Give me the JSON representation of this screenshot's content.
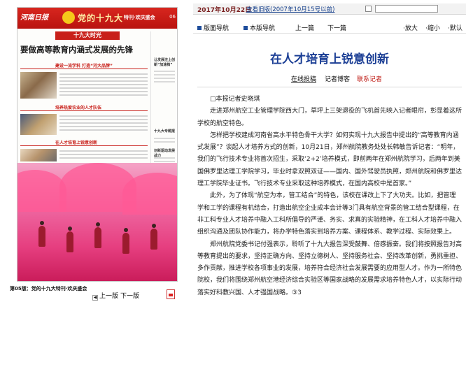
{
  "newspaper": {
    "masthead_logo": "河南日报",
    "masthead_title": "党的十九大",
    "masthead_sub": "特刊·欢庆盛会",
    "page_no": "06",
    "kicker": "十九大时光",
    "headline": "要做高等教育内涵式发展的先锋",
    "side_text_1": "让发展注上创新“加速档”",
    "side_text_2": "十九大专题报",
    "side_text_3": "创新驱动发展战力",
    "section_1": "建设一流学科  打造“河大品牌”",
    "section_2": "培养热爱农业的人才队伍",
    "section_3": "在人才培育上锐意创新"
  },
  "page_nav": {
    "label": "第05版：党的十九大特刊·欢庆盛会",
    "prev": "上一版",
    "next": "下一版",
    "pdf_icon": "pdf-icon"
  },
  "topbar": {
    "date": "2017年10月22日",
    "history_link": "查看旧版(2007年10月15号以前)"
  },
  "navbar": {
    "layout_nav": "版面导航",
    "page_nav": "本版导航",
    "prev_article": "上一篇",
    "next_article": "下一篇",
    "zoom_in": "放大",
    "zoom_out": "缩小",
    "default": "默认"
  },
  "article": {
    "title": "在人才培育上锐意创新",
    "meta_1": "在线投稿",
    "meta_2": "记者博客",
    "meta_3": "联系记者",
    "byline": "□本报记者史晓琪",
    "paragraphs": [
      "走进郑州航空工业管理学院西大门，草坪上三架退役的飞机首先映入记者眼帘，彰显着这所学校的航空特色。",
      "怎样把学校建成河南省高水平特色骨干大学？如何实现十九大报告中提出的“高等教育内涵式发展”？谈起人才培养方式的创新，10月21日，郑州航院教务处处长韩敏告诉记者：“明年，我们的飞行技术专业将首次招生，采取‘2+2’培养模式，即前两年在郑州航院学习，后两年到美国佛罗里达理工学院学习，毕业时拿双照双证——国内、国外驾驶员执照，郑州航院和佛罗里达理工学院毕业证书。飞行技术专业采取这种培养模式，在国内高校中是首家。”",
      "此外，为了体现“航空为本，管工结合”的特色，该校在课改上下了大功夫。比如，把管理学和工学的课程有机结合，打造出航空企业成本会计等3门具有航空背景的管工结合型课程，在非工科专业人才培养中融入工科所倡导的严谨、务实、求真的实验精神，在工科人才培养中融入组织沟通及团队协作能力，将办学特色落实到培养方案、课程体系、教学过程、实际效果上。",
      "郑州航院党委书记付强表示，聆听了十九大报告深受鼓舞、倍感振奋。我们将按照报告对高等教育提出的要求，坚持正确方向、坚持立德树人、坚持服务社会、坚持改革创新，勇挑重担、多作贡献，推进学校各项事业的发展，培养符合经济社会发展需要的应用型人才。作为一所特色院校，我们将围绕郑州航空港经济综合实验区等国家战略的发展需求培养特色人才，以实际行动落实好科教兴国、人才强国战略。③3"
    ]
  }
}
